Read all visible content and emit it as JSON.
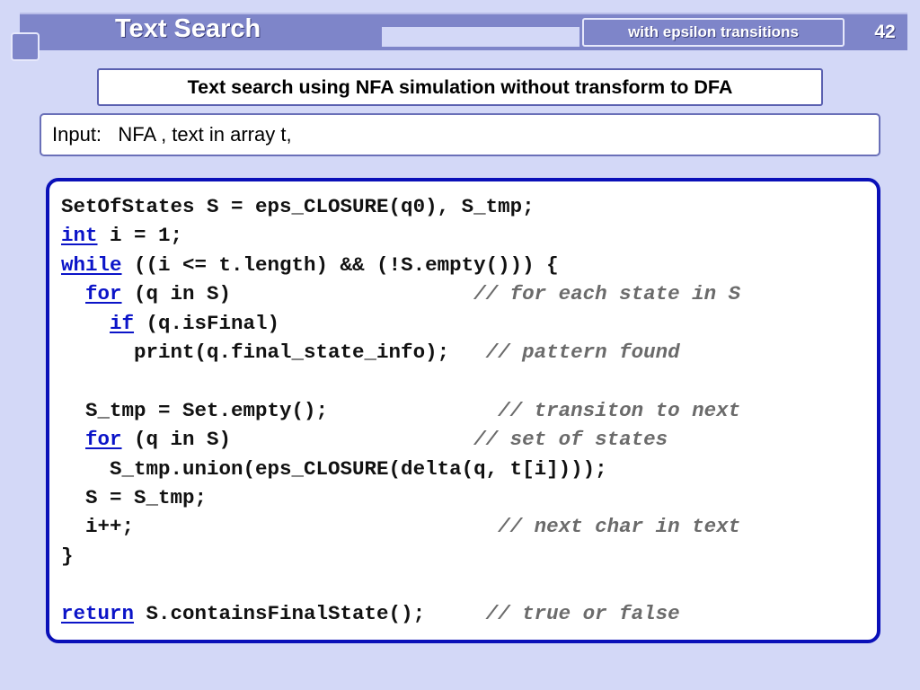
{
  "header": {
    "title": "Text Search",
    "subtitle": "with epsilon transitions",
    "page_number": "42"
  },
  "heading": "Text search using NFA simulation without transform to  DFA",
  "input_line": "Input:   NFA , text in array t,",
  "code": {
    "lines": [
      {
        "pre": "SetOfStates S = eps_CLOSURE(q0), S_tmp;",
        "kw": "",
        "rest": "",
        "pad": "",
        "comment": ""
      },
      {
        "pre": "",
        "kw": "int",
        "rest": " i = 1;",
        "pad": "",
        "comment": ""
      },
      {
        "pre": "",
        "kw": "while",
        "rest": " ((i <= t.length) && (!S.empty())) {",
        "pad": "",
        "comment": ""
      },
      {
        "pre": "  ",
        "kw": "for",
        "rest": " (q in S)",
        "pad": "                    ",
        "comment": "// for each state in S"
      },
      {
        "pre": "    ",
        "kw": "if",
        "rest": " (q.isFinal)",
        "pad": "",
        "comment": ""
      },
      {
        "pre": "      print(q.final_state_info);",
        "kw": "",
        "rest": "",
        "pad": "   ",
        "comment": "// pattern found"
      },
      {
        "pre": "",
        "kw": "",
        "rest": "",
        "pad": "",
        "comment": ""
      },
      {
        "pre": "  S_tmp = Set.empty();",
        "kw": "",
        "rest": "",
        "pad": "              ",
        "comment": "// transiton to next"
      },
      {
        "pre": "  ",
        "kw": "for",
        "rest": " (q in S)",
        "pad": "                    ",
        "comment": "// set of states"
      },
      {
        "pre": "    S_tmp.union(eps_CLOSURE(delta(q, t[i])));",
        "kw": "",
        "rest": "",
        "pad": "",
        "comment": ""
      },
      {
        "pre": "  S = S_tmp;",
        "kw": "",
        "rest": "",
        "pad": "",
        "comment": ""
      },
      {
        "pre": "  i++;",
        "kw": "",
        "rest": "",
        "pad": "                              ",
        "comment": "// next char in text"
      },
      {
        "pre": "}",
        "kw": "",
        "rest": "",
        "pad": "",
        "comment": ""
      },
      {
        "pre": "",
        "kw": "",
        "rest": "",
        "pad": "",
        "comment": ""
      },
      {
        "pre": "",
        "kw": "return",
        "rest": " S.containsFinalState();",
        "pad": "     ",
        "comment": "// true or false"
      }
    ]
  },
  "colors": {
    "background": "#d3d8f7",
    "header_bar": "#7e85c9",
    "code_border": "#0a10b8",
    "keyword": "#0b14c8",
    "comment": "#6b6b6b"
  }
}
